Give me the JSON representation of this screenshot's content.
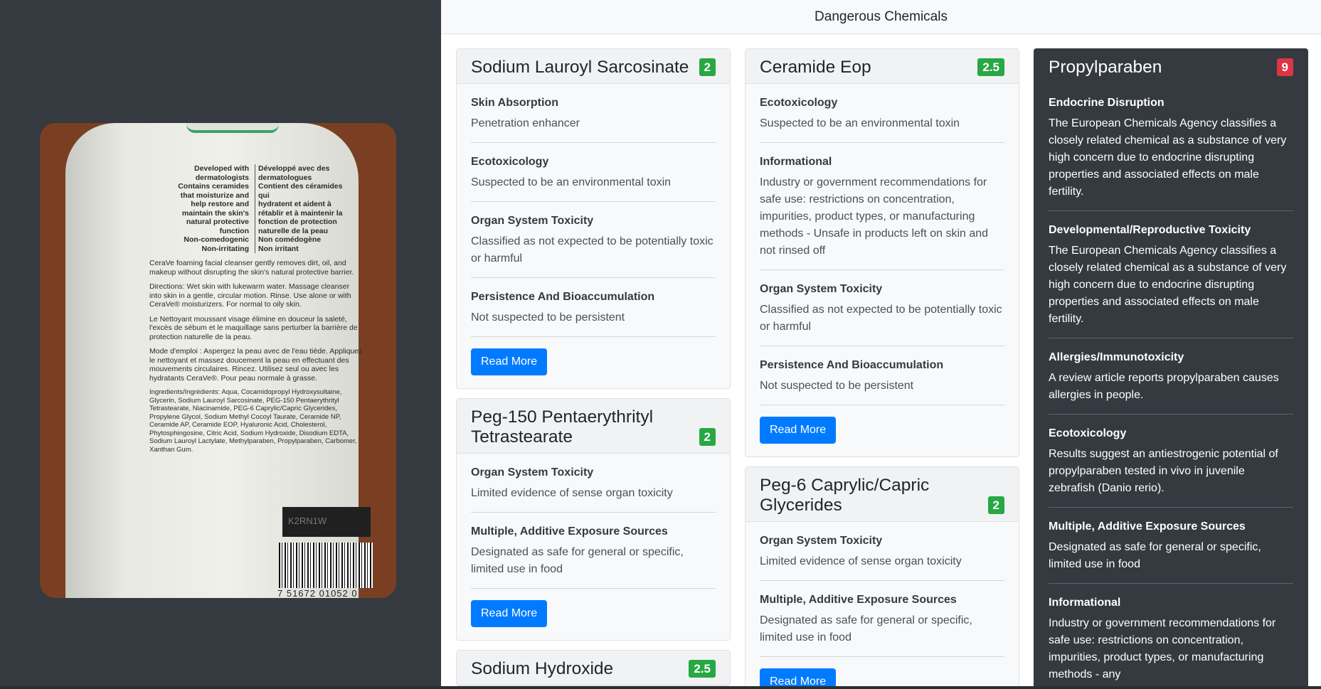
{
  "page_title": "Dangerous Chemicals",
  "photo": {
    "left_col": [
      "Developed with",
      "dermatologists",
      "Contains ceramides",
      "that moisturize and",
      "help restore and",
      "maintain the skin's",
      "natural protective",
      "function",
      "Non-comedogenic",
      "Non-irritating"
    ],
    "right_col": [
      "Développé avec des",
      "dermatologues",
      "Contient des céramides qui",
      "hydratent et aident à",
      "rétablir et à maintenir la",
      "fonction de protection",
      "naturelle de la peau",
      "Non comédogène",
      "Non irritant"
    ],
    "para1": "CeraVe foaming facial cleanser gently removes dirt, oil, and makeup without disrupting the skin's natural protective barrier.",
    "para2": "Directions: Wet skin with lukewarm water. Massage cleanser into skin in a gentle, circular motion. Rinse. Use alone or with CeraVe® moisturizers. For normal to oily skin.",
    "para3": "Le Nettoyant moussant visage élimine en douceur la saleté, l'excès de sébum et le maquillage sans perturber la barrière de protection naturelle de la peau.",
    "para4": "Mode d'emploi : Aspergez la peau avec de l'eau tiède. Appliquez le nettoyant et massez doucement la peau en effectuant des mouvements circulaires. Rincez. Utilisez seul ou avec les hydratants CeraVe®. Pour peau normale à grasse.",
    "ingredients": "Ingredients/Ingrédients: Aqua, Cocamidopropyl Hydroxysultaine, Glycerin, Sodium Lauroyl Sarcosinate, PEG-150 Pentaerythrityl Tetrastearate, Niacinamide, PEG-6 Caprylic/Capric Glycerides, Propylene Glycol, Sodium Methyl Cocoyl Taurate, Ceramide NP, Ceramide AP, Ceramide EOP, Hyaluronic Acid, Cholesterol, Phytosphingosine, Citric Acid, Sodium Hydroxide, Disodium EDTA, Sodium Lauroyl Lactylate, Methylparaben, Propylparaben, Carbomer, Xanthan Gum.",
    "lot_code": "K2RN1W",
    "barcode_number": "7 51672 01052 0"
  },
  "cards": {
    "c1": {
      "title": "Sodium Lauroyl Sarcosinate",
      "score": "2",
      "items": [
        {
          "title": "Skin Absorption",
          "text": "Penetration enhancer"
        },
        {
          "title": "Ecotoxicology",
          "text": "Suspected to be an environmental toxin"
        },
        {
          "title": "Organ System Toxicity",
          "text": "Classified as not expected to be potentially toxic or harmful"
        },
        {
          "title": "Persistence And Bioaccumulation",
          "text": "Not suspected to be persistent"
        }
      ],
      "button": "Read More"
    },
    "c2": {
      "title": "Peg-150 Pentaerythrityl Tetrastearate",
      "score": "2",
      "items": [
        {
          "title": "Organ System Toxicity",
          "text": "Limited evidence of sense organ toxicity"
        },
        {
          "title": "Multiple, Additive Exposure Sources",
          "text": "Designated as safe for general or specific, limited use in food"
        }
      ],
      "button": "Read More"
    },
    "c3": {
      "title": "Sodium Hydroxide",
      "score": "2.5"
    },
    "c4": {
      "title": "Ceramide Eop",
      "score": "2.5",
      "items": [
        {
          "title": "Ecotoxicology",
          "text": "Suspected to be an environmental toxin"
        },
        {
          "title": "Informational",
          "text": "Industry or government recommendations for safe use: restrictions on concentration, impurities, product types, or manufacturing methods - Unsafe in products left on skin and not rinsed off"
        },
        {
          "title": "Organ System Toxicity",
          "text": "Classified as not expected to be potentially toxic or harmful"
        },
        {
          "title": "Persistence And Bioaccumulation",
          "text": "Not suspected to be persistent"
        }
      ],
      "button": "Read More"
    },
    "c5": {
      "title": "Peg-6 Caprylic/Capric Glycerides",
      "score": "2",
      "items": [
        {
          "title": "Organ System Toxicity",
          "text": "Limited evidence of sense organ toxicity"
        },
        {
          "title": "Multiple, Additive Exposure Sources",
          "text": "Designated as safe for general or specific, limited use in food"
        }
      ],
      "button": "Read More"
    },
    "c6": {
      "title": "Propylparaben",
      "score": "9",
      "items": [
        {
          "title": "Endocrine Disruption",
          "text": "The European Chemicals Agency classifies a closely related chemical as a substance of very high concern due to endocrine disrupting properties and associated effects on male fertility."
        },
        {
          "title": "Developmental/Reproductive Toxicity",
          "text": "The European Chemicals Agency classifies a closely related chemical as a substance of very high concern due to endocrine disrupting properties and associated effects on male fertility."
        },
        {
          "title": "Allergies/Immunotoxicity",
          "text": "A review article reports propylparaben causes allergies in people."
        },
        {
          "title": "Ecotoxicology",
          "text": "Results suggest an antiestrogenic potential of propylparaben tested in vivo in juvenile zebrafish (Danio rerio)."
        },
        {
          "title": "Multiple, Additive Exposure Sources",
          "text": "Designated as safe for general or specific, limited use in food"
        },
        {
          "title": "Informational",
          "text": "Industry or government recommendations for safe use: restrictions on concentration, impurities, product types, or manufacturing methods - any"
        }
      ]
    }
  },
  "colors": {
    "badge_low": "#28a745",
    "badge_high": "#dc3545",
    "button": "#007bff",
    "dark": "#343a40"
  }
}
